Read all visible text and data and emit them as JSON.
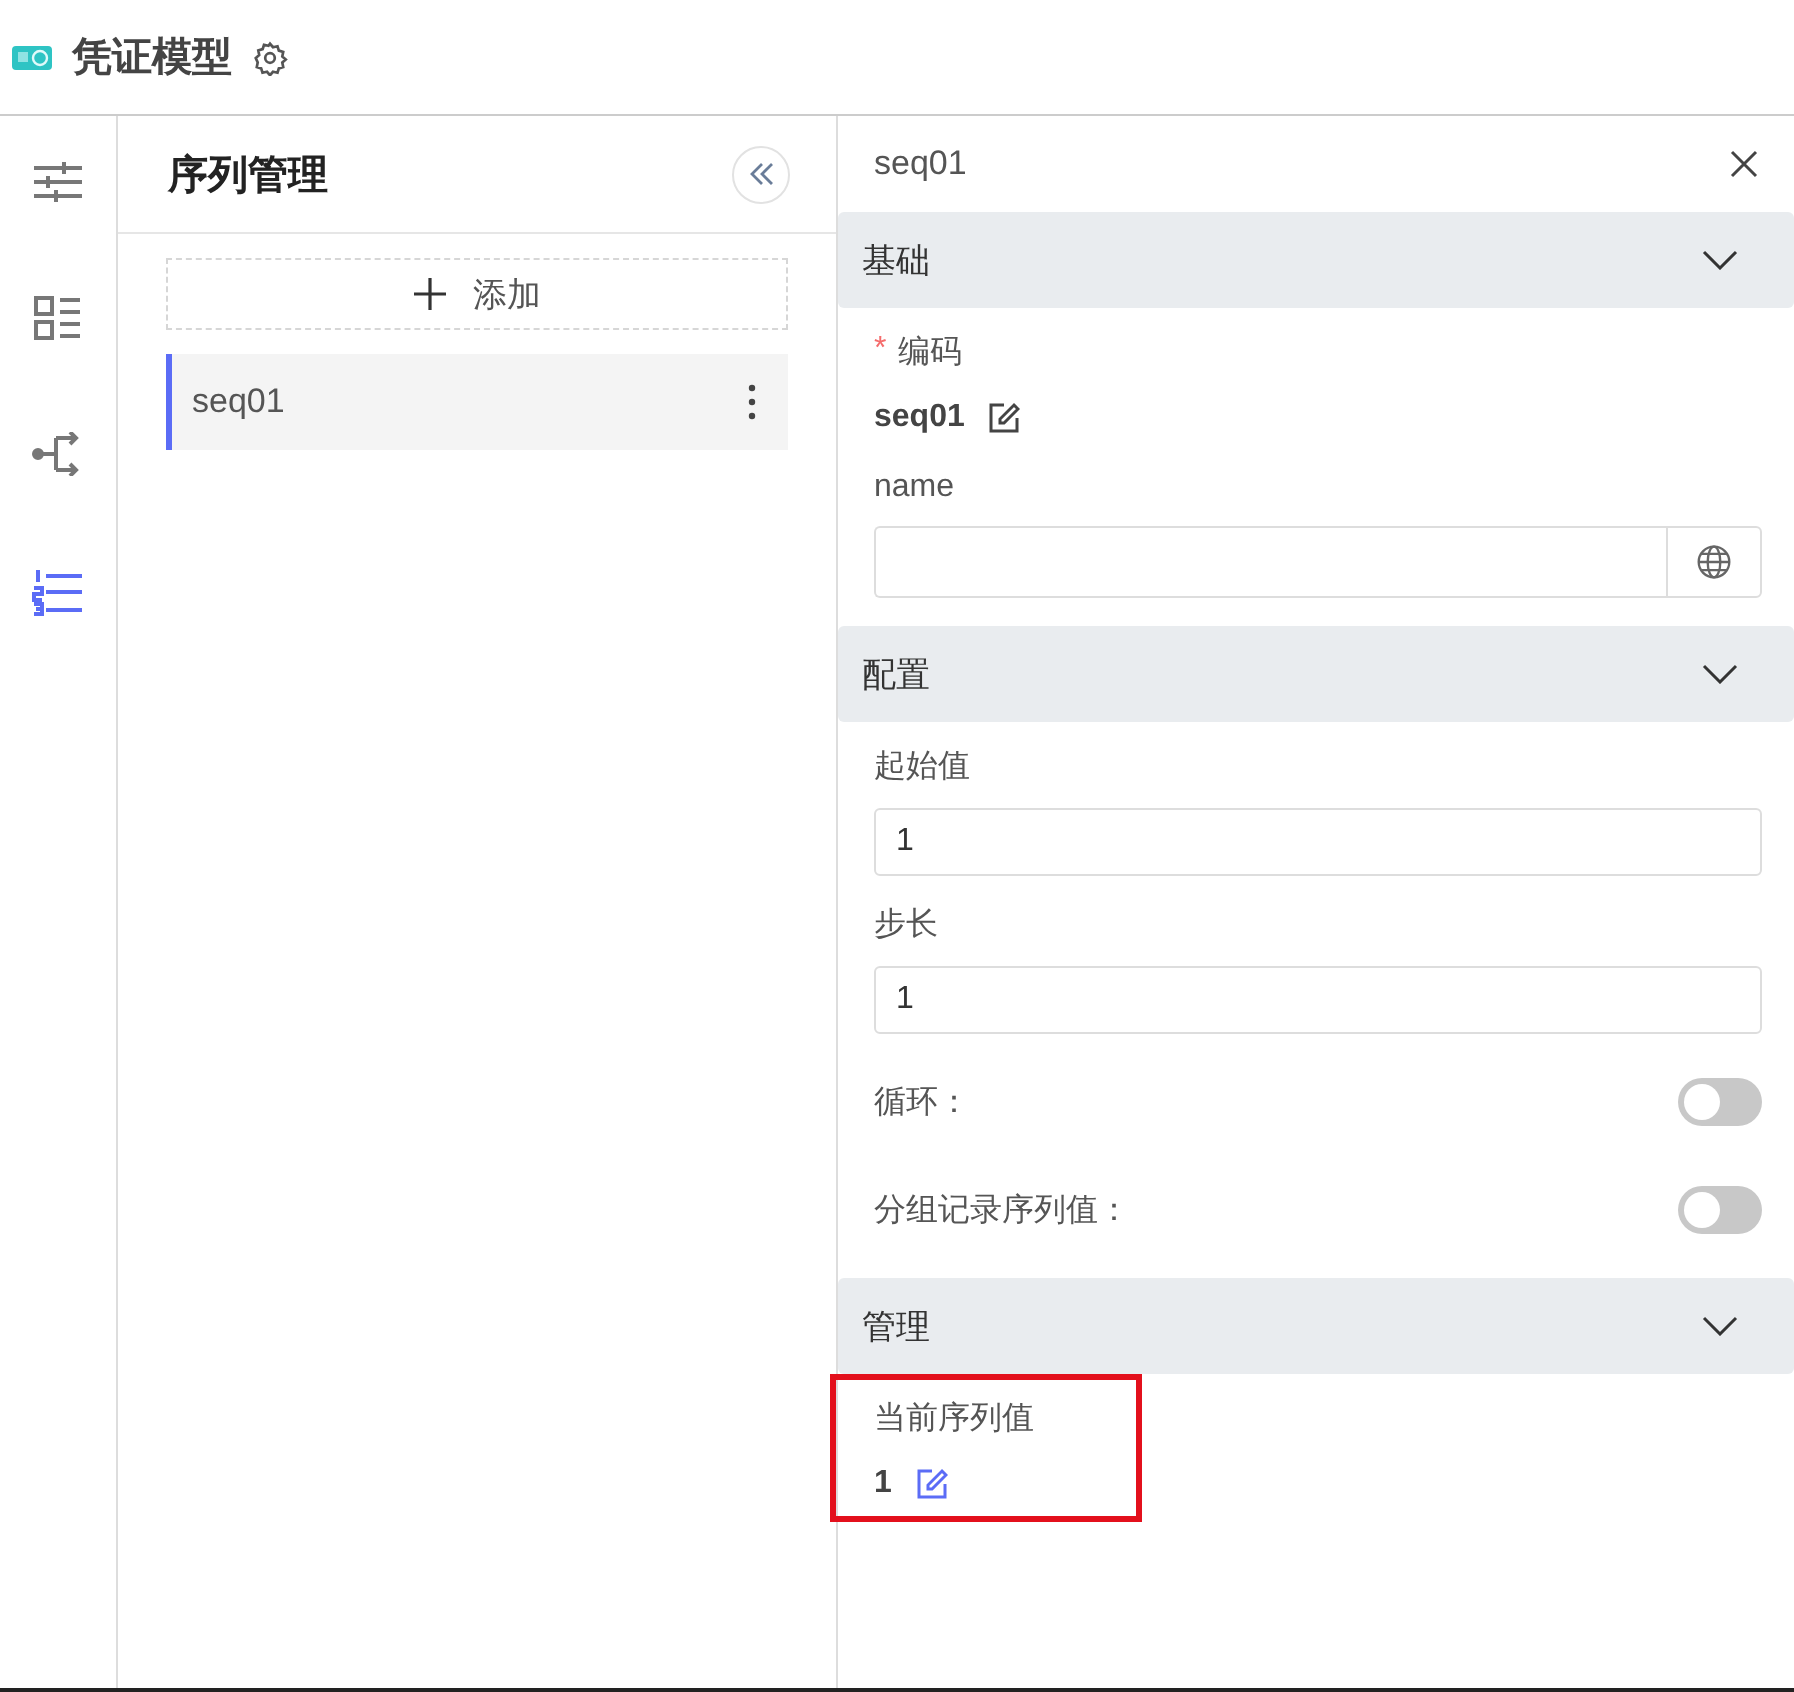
{
  "header": {
    "title": "凭证模型"
  },
  "rail": [
    {
      "kind": "sliders",
      "selected": false
    },
    {
      "kind": "grid-list",
      "selected": false
    },
    {
      "kind": "branch",
      "selected": false
    },
    {
      "kind": "numbered-list",
      "selected": true
    }
  ],
  "list_panel": {
    "title": "序列管理",
    "add_label": "添加",
    "items": [
      {
        "label": "seq01",
        "selected": true
      }
    ]
  },
  "detail": {
    "title": "seq01",
    "sections": [
      {
        "title": "基础",
        "expanded": true,
        "fields": [
          {
            "kind": "readonly",
            "label": "编码",
            "required_mark": "*",
            "value": "seq01",
            "highlighted": false
          },
          {
            "kind": "i18n-input",
            "label": "name"
          }
        ]
      },
      {
        "title": "配置",
        "expanded": true,
        "fields": [
          {
            "kind": "input",
            "label": "起始值",
            "value": "1"
          },
          {
            "kind": "input",
            "label": "步长",
            "value": "1"
          },
          {
            "kind": "switch",
            "label": "循环：",
            "on": false
          },
          {
            "kind": "switch",
            "label": "分组记录序列值：",
            "on": false
          }
        ]
      },
      {
        "title": "管理",
        "expanded": true,
        "fields": [
          {
            "kind": "readonly",
            "label": "当前序列值",
            "value": "1",
            "highlighted": true
          }
        ]
      }
    ]
  }
}
